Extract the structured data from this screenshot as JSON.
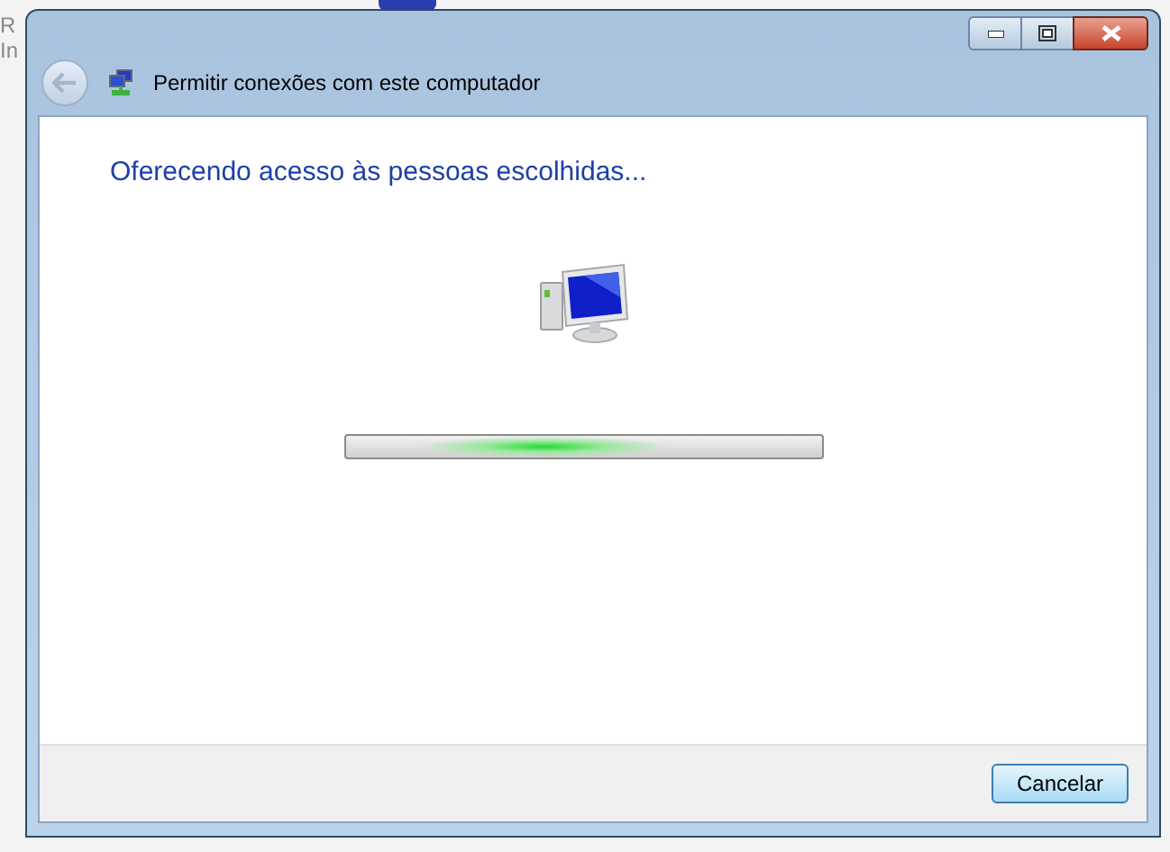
{
  "background": {
    "texts": [
      "R",
      "In"
    ]
  },
  "window": {
    "title": "Permitir conexões com este computador",
    "back_disabled": true
  },
  "content": {
    "heading": "Oferecendo acesso às pessoas escolhidas...",
    "progress": {
      "indeterminate": true
    }
  },
  "buttons": [
    {
      "label": "Cancelar",
      "default": true
    }
  ]
}
